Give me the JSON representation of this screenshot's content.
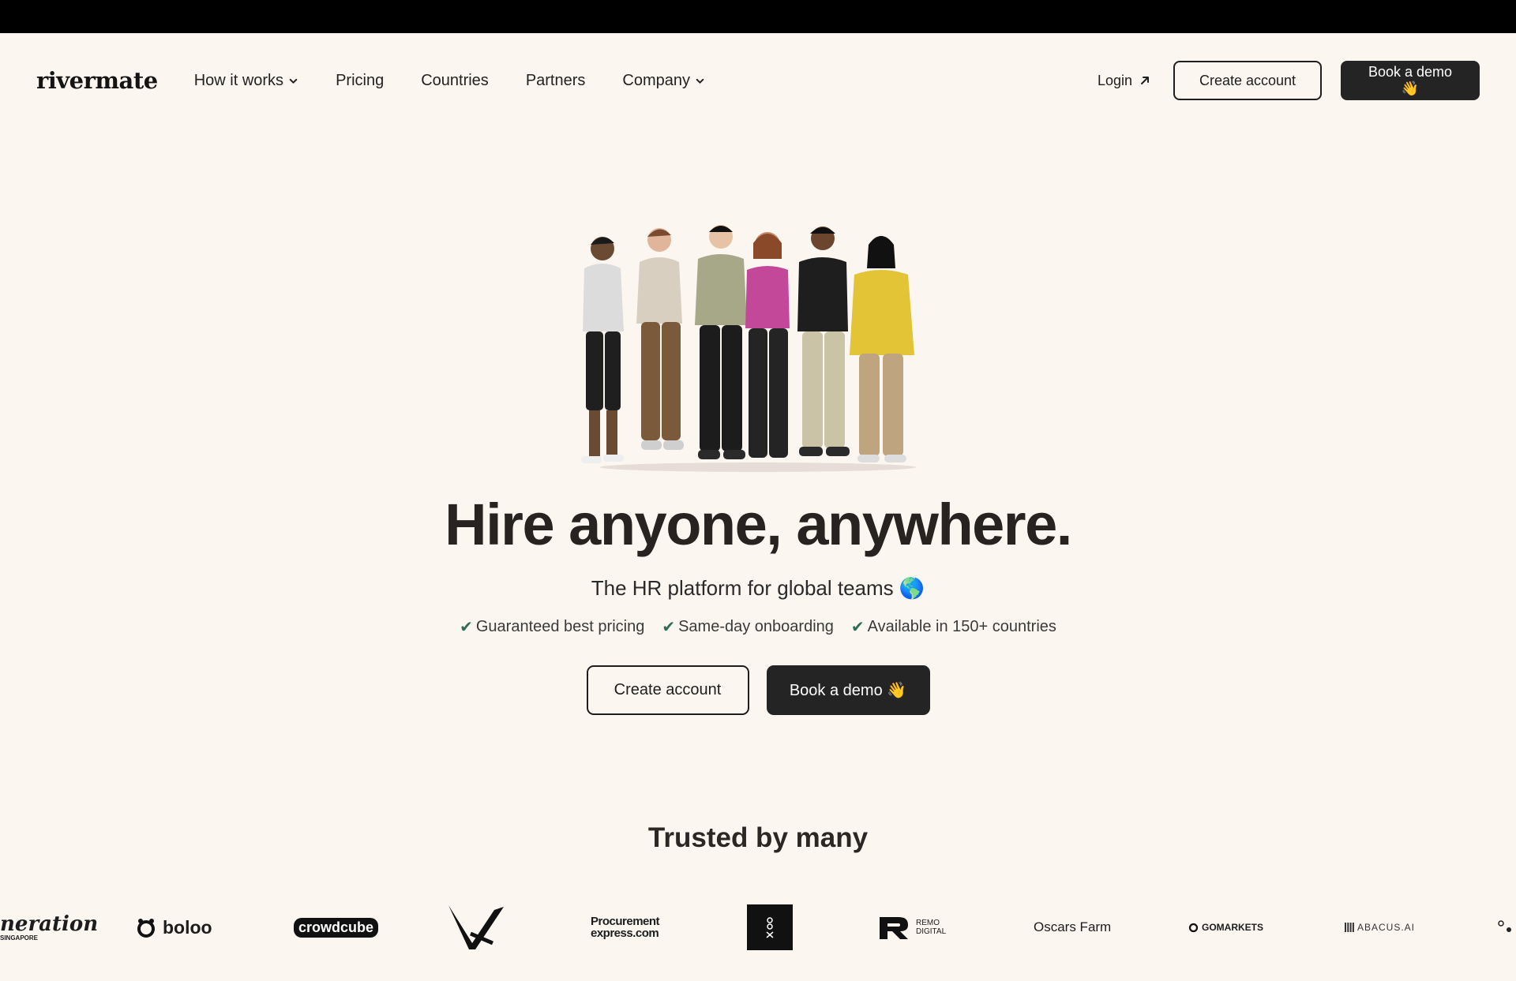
{
  "brand": {
    "logo": "rivermate"
  },
  "nav": {
    "links": [
      {
        "label": "How it works",
        "dropdown": true
      },
      {
        "label": "Pricing",
        "dropdown": false
      },
      {
        "label": "Countries",
        "dropdown": false
      },
      {
        "label": "Partners",
        "dropdown": false
      },
      {
        "label": "Company",
        "dropdown": true
      }
    ],
    "login_label": "Login",
    "create_account_label": "Create account",
    "book_demo_label": "Book a demo 👋"
  },
  "hero": {
    "headline": "Hire anyone, anywhere.",
    "subheadline": "The HR platform for global teams 🌎",
    "checks": [
      "Guaranteed best pricing",
      "Same-day onboarding",
      "Available in 150+ countries"
    ],
    "check_glyph": "✔",
    "cta_create": "Create account",
    "cta_demo": "Book a demo 👋"
  },
  "trusted": {
    "title": "Trusted by many",
    "logos": {
      "generation_a": "neration",
      "generation_b": "SINGAPORE",
      "boloo": "boloo",
      "crowdcube": "crowdcube",
      "procurement_a": "Procurement",
      "procurement_b": "express.com",
      "remo_a": "REMO",
      "remo_b": "DIGITAL",
      "oscars": "Oscars Farm",
      "gomarkets": "GOMARKETS",
      "abacus": "ABACUS.AI"
    }
  },
  "colors": {
    "background": "#fcf6f1",
    "dark_button": "#242424",
    "check_green": "#2e6e55",
    "text": "#1d1d1d"
  }
}
